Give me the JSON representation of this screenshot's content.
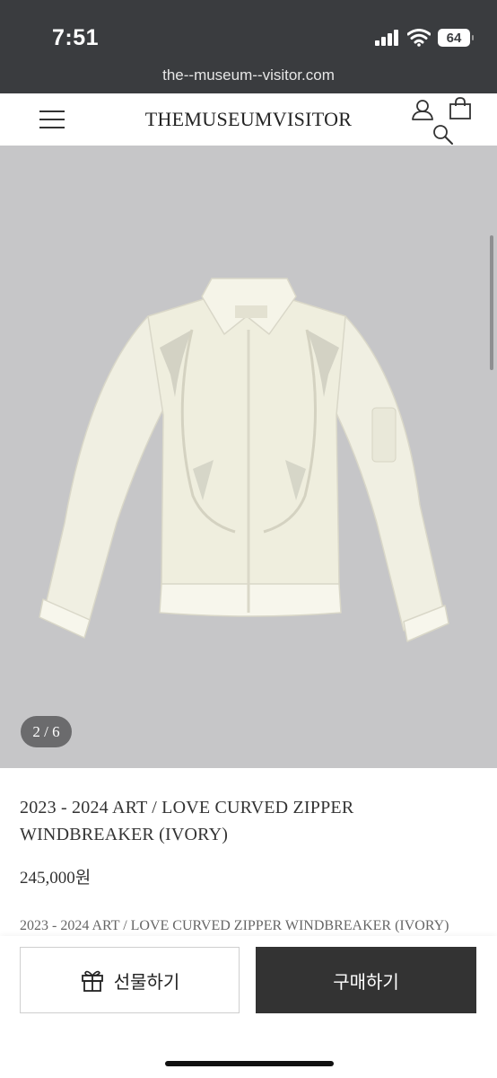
{
  "status_bar": {
    "time": "7:51",
    "battery": "64"
  },
  "browser": {
    "url": "the--museum--visitor.com"
  },
  "header": {
    "logo": "THEMUSEUMVISITOR",
    "icons": [
      "menu-icon",
      "user-icon",
      "shopping-bag-icon",
      "search-icon"
    ]
  },
  "gallery": {
    "pager": "2 / 6",
    "image_alt": "ivory sheer zip windbreaker jacket"
  },
  "product": {
    "title": "2023 - 2024 ART / LOVE CURVED ZIPPER WINDBREAKER (IVORY)",
    "price": "245,000원",
    "description_preview": "2023 - 2024 ART / LOVE CURVED ZIPPER WINDBREAKER (IVORY)"
  },
  "actions": {
    "gift_label": "선물하기",
    "buy_label": "구매하기"
  },
  "colors": {
    "topbar": "#3a3c3f",
    "image_bg": "#c6c6c8",
    "buy_button": "#333333"
  }
}
